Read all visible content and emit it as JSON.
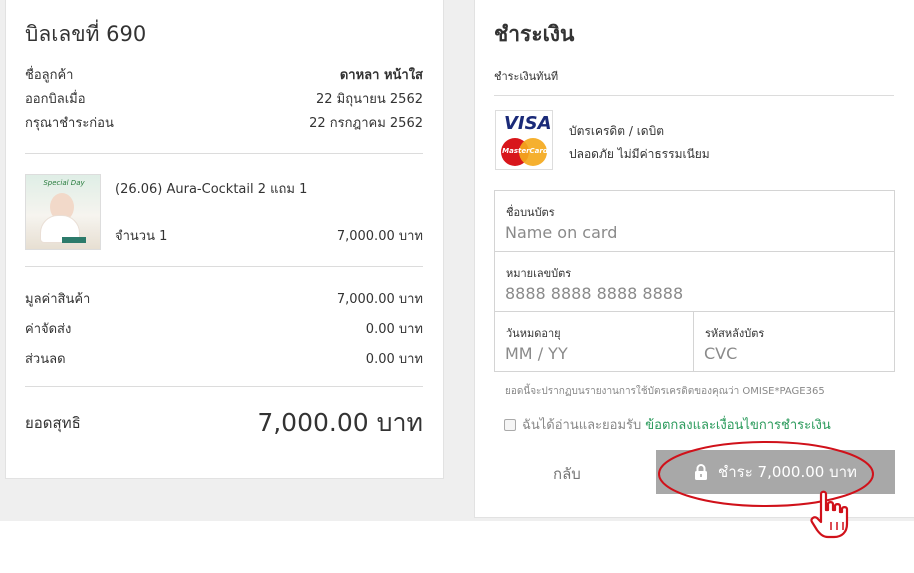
{
  "bill": {
    "title": "บิลเลขที่ 690",
    "customer_label": "ชื่อลูกค้า",
    "customer_value": "ดาหลา หน้าใส",
    "issued_label": "ออกบิลเมื่อ",
    "issued_value": "22 มิถุนายน 2562",
    "due_label": "กรุณาชำระก่อน",
    "due_value": "22 กรกฎาคม 2562",
    "product": {
      "thumb_text": "Special Day",
      "name": "(26.06) Aura-Cocktail 2 แถม 1",
      "qty_label": "จำนวน 1",
      "price": "7,000.00 บาท"
    },
    "subtotal_label": "มูลค่าสินค้า",
    "subtotal_value": "7,000.00 บาท",
    "shipping_label": "ค่าจัดส่ง",
    "shipping_value": "0.00 บาท",
    "discount_label": "ส่วนลด",
    "discount_value": "0.00 บาท",
    "total_label": "ยอดสุทธิ",
    "total_value": "7,000.00 บาท"
  },
  "payment": {
    "title": "ชำระเงิน",
    "subtitle": "ชำระเงินทันที",
    "card_logo_visa": "VISA",
    "card_logo_mc": "MasterCard",
    "card_type": "บัตรเครดิต / เดบิต",
    "card_desc": "ปลอดภัย ไม่มีค่าธรรมเนียม",
    "name_label": "ชื่อบนบัตร",
    "name_placeholder": "Name on card",
    "number_label": "หมายเลขบัตร",
    "number_placeholder": "8888 8888 8888 8888",
    "expiry_label": "วันหมดอายุ",
    "expiry_placeholder": "MM / YY",
    "cvc_label": "รหัสหลังบัตร",
    "cvc_placeholder": "CVC",
    "statement_note": "ยอดนี้จะปรากฏบนรายงานการใช้บัตรเครดิตของคุณว่า OMISE*PAGE365",
    "agree_text": "ฉันได้อ่านและยอมรับ",
    "agree_link": "ข้อตกลงและเงื่อนไขการชำระเงิน",
    "agree_checked": false,
    "back_label": "กลับ",
    "pay_label": "ชำระ 7,000.00 บาท"
  },
  "colors": {
    "pay_button": "#a8a8a8",
    "link": "#2a9a5b",
    "highlight": "#d0111a"
  },
  "icons": {
    "lock": "lock-icon",
    "pointer": "hand-pointer-icon"
  }
}
